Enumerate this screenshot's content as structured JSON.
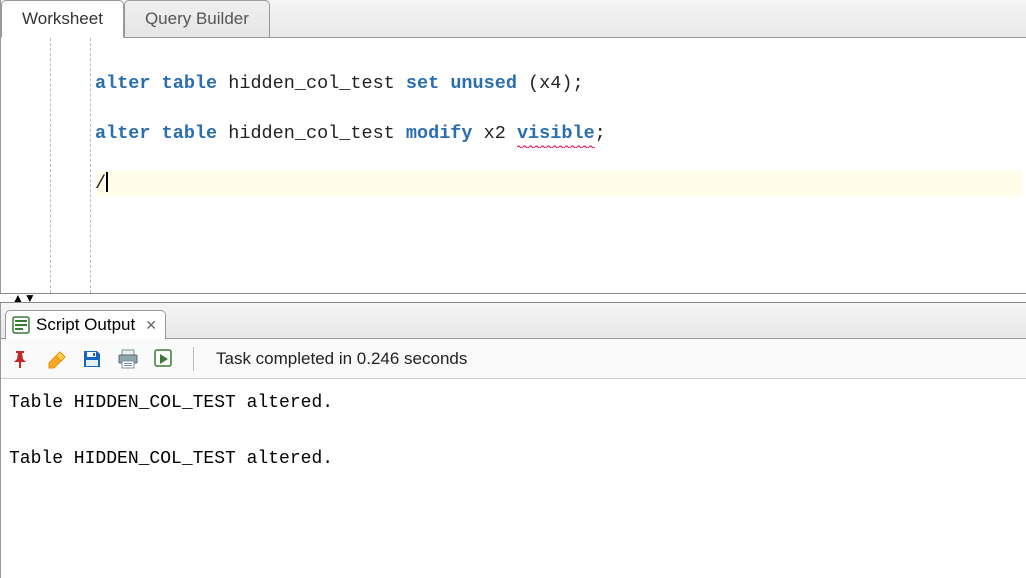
{
  "tabs": {
    "worksheet": "Worksheet",
    "queryBuilder": "Query Builder"
  },
  "code": {
    "line1": {
      "k_alter": "alter",
      "k_table": "table",
      "ident": "hidden_col_test",
      "k_set": "set",
      "k_unused": "unused",
      "paren_open": "(",
      "col": "x4",
      "paren_close": ")",
      "semi": ";"
    },
    "line2": {
      "k_alter": "alter",
      "k_table": "table",
      "ident": "hidden_col_test",
      "k_modify": "modify",
      "col": "x2",
      "k_visible": "visible",
      "semi": ";"
    },
    "line3": {
      "slash": "/"
    }
  },
  "outputTab": {
    "label": "Script Output"
  },
  "toolbar": {
    "task": "Task completed in 0.246 seconds"
  },
  "output": {
    "line1": "Table HIDDEN_COL_TEST altered.",
    "blank": "",
    "line2": "Table HIDDEN_COL_TEST altered."
  }
}
